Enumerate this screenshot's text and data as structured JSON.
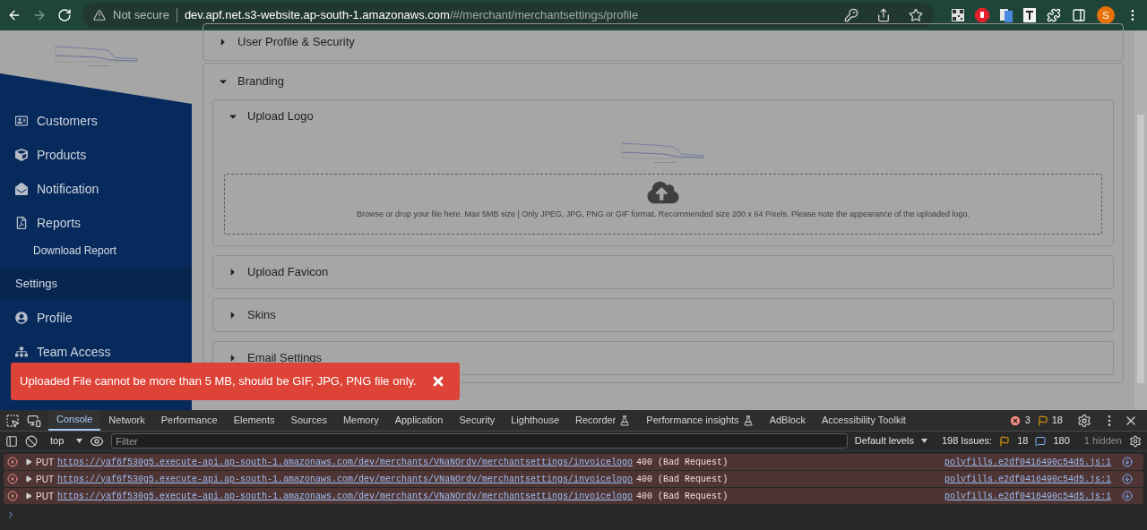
{
  "browser": {
    "security": "Not secure",
    "host": "dev.apf.net.s3-website.ap-south-1.amazonaws.com",
    "path": "/#/merchant/merchantsettings/profile",
    "avatar": "S"
  },
  "sidebar": {
    "items": [
      {
        "kind": "nav",
        "label": "Customers"
      },
      {
        "kind": "nav",
        "label": "Products"
      },
      {
        "kind": "nav",
        "label": "Notification"
      },
      {
        "kind": "nav",
        "label": "Reports"
      },
      {
        "kind": "sub",
        "label": "Download Report"
      },
      {
        "kind": "section",
        "label": "Settings"
      },
      {
        "kind": "nav",
        "label": "Profile"
      },
      {
        "kind": "nav",
        "label": "Team Access"
      }
    ]
  },
  "panels": [
    {
      "title": "User Profile & Security",
      "expanded": false
    },
    {
      "title": "Branding",
      "expanded": true,
      "children": [
        {
          "title": "Upload Logo",
          "expanded": true,
          "upload_hint": "Browse or drop your file here. Max 5MB size | Only JPEG, JPG, PNG or GIF format. Recommended size 200 x 64 Pixels. Please note the appearance of the uploaded logo."
        },
        {
          "title": "Upload Favicon",
          "expanded": false
        },
        {
          "title": "Skins",
          "expanded": false
        },
        {
          "title": "Email Settings",
          "expanded": false
        }
      ]
    }
  ],
  "toast": {
    "message": "Uploaded File cannot be more than 5 MB, should be GIF, JPG, PNG file only."
  },
  "devtools": {
    "tabs": [
      {
        "label": "Console",
        "selected": true,
        "experimental": false
      },
      {
        "label": "Network",
        "selected": false,
        "experimental": false
      },
      {
        "label": "Performance",
        "selected": false,
        "experimental": false
      },
      {
        "label": "Elements",
        "selected": false,
        "experimental": false
      },
      {
        "label": "Sources",
        "selected": false,
        "experimental": false
      },
      {
        "label": "Memory",
        "selected": false,
        "experimental": false
      },
      {
        "label": "Application",
        "selected": false,
        "experimental": false
      },
      {
        "label": "Security",
        "selected": false,
        "experimental": false
      },
      {
        "label": "Lighthouse",
        "selected": false,
        "experimental": false
      },
      {
        "label": "Recorder",
        "selected": false,
        "experimental": true
      },
      {
        "label": "Performance insights",
        "selected": false,
        "experimental": true
      },
      {
        "label": "AdBlock",
        "selected": false,
        "experimental": false
      },
      {
        "label": "Accessibility Toolkit",
        "selected": false,
        "experimental": false
      }
    ],
    "error_count": "3",
    "warning_count": "18",
    "context": "top",
    "filter_placeholder": "Filter",
    "levels": "Default levels",
    "issues_label": "198 Issues:",
    "issues_warnings": "18",
    "issues_info": "180",
    "hidden": "1 hidden",
    "messages": [
      {
        "method": "PUT",
        "url": "https://yaf6f530g5.execute-api.ap-south-1.amazonaws.com/dev/merchants/VNaNOrdv/merchantsettings/invoicelogo",
        "status": "400 (Bad Request)",
        "source": "polyfills.e2df0416490c54d5.js:1"
      },
      {
        "method": "PUT",
        "url": "https://yaf6f530g5.execute-api.ap-south-1.amazonaws.com/dev/merchants/VNaNOrdv/merchantsettings/invoicelogo",
        "status": "400 (Bad Request)",
        "source": "polyfills.e2df0416490c54d5.js:1"
      },
      {
        "method": "PUT",
        "url": "https://yaf6f530g5.execute-api.ap-south-1.amazonaws.com/dev/merchants/VNaNOrdv/merchantsettings/invoicelogo",
        "status": "400 (Bad Request)",
        "source": "polyfills.e2df0416490c54d5.js:1"
      }
    ]
  }
}
